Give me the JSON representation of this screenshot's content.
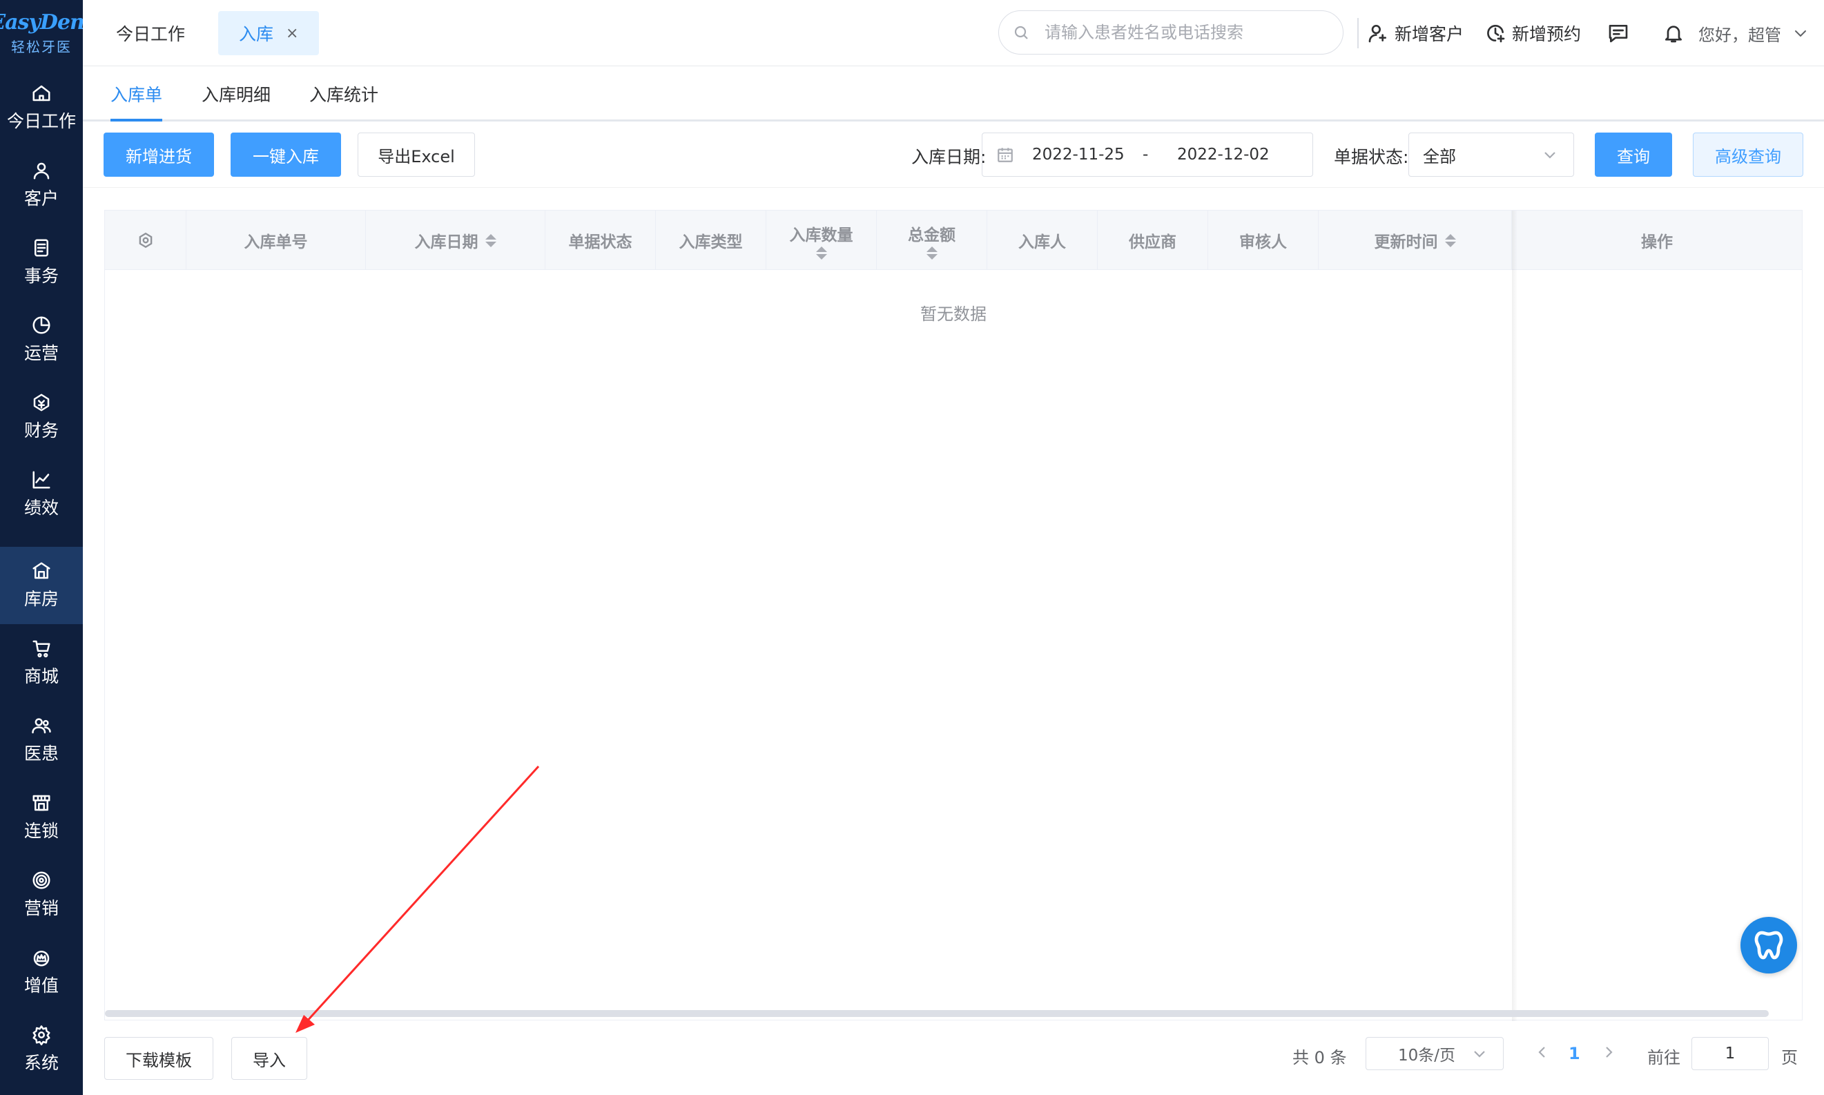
{
  "brand": {
    "logo_main": "EasyDent",
    "logo_sub": "轻松牙医"
  },
  "sidebar": {
    "items": [
      {
        "label": "今日工作",
        "icon": "home-icon"
      },
      {
        "label": "客户",
        "icon": "user-icon"
      },
      {
        "label": "事务",
        "icon": "task-icon"
      },
      {
        "label": "运营",
        "icon": "pie-chart-icon"
      },
      {
        "label": "财务",
        "icon": "finance-icon"
      },
      {
        "label": "绩效",
        "icon": "line-chart-icon"
      },
      {
        "label": "库房",
        "icon": "warehouse-icon",
        "active": true
      },
      {
        "label": "商城",
        "icon": "cart-icon"
      },
      {
        "label": "医患",
        "icon": "people-icon"
      },
      {
        "label": "连锁",
        "icon": "store-icon"
      },
      {
        "label": "营销",
        "icon": "target-icon"
      },
      {
        "label": "增值",
        "icon": "crown-icon"
      },
      {
        "label": "系统",
        "icon": "gear-icon"
      }
    ]
  },
  "topbar": {
    "tabs": [
      {
        "label": "今日工作"
      },
      {
        "label": "入库",
        "active": true,
        "close": "×"
      }
    ],
    "search_placeholder": "请输入患者姓名或电话搜索",
    "add_customer": "新增客户",
    "add_appointment": "新增预约",
    "greeting": "您好，超管"
  },
  "subtabs": [
    {
      "label": "入库单",
      "active": true
    },
    {
      "label": "入库明细"
    },
    {
      "label": "入库统计"
    }
  ],
  "toolbar": {
    "new_purchase": "新增进货",
    "one_click_stock_in": "一键入库",
    "export_excel": "导出Excel",
    "date_label": "入库日期:",
    "date_start": "2022-11-25",
    "date_sep": "-",
    "date_end": "2022-12-02",
    "status_label": "单据状态:",
    "status_value": "全部",
    "query": "查询",
    "advanced_query": "高级查询"
  },
  "table": {
    "columns": [
      "入库单号",
      "入库日期",
      "单据状态",
      "入库类型",
      "入库数量",
      "总金额",
      "入库人",
      "供应商",
      "审核人",
      "更新时间",
      "操作"
    ],
    "empty_text": "暂无数据"
  },
  "bottom": {
    "download_template": "下载模板",
    "import": "导入",
    "total": "共 0 条",
    "page_size": "10条/页",
    "current_page": "1",
    "goto_label": "前往",
    "goto_value": "1",
    "page_unit": "页"
  },
  "colors": {
    "primary": "#409eff",
    "sidebar_bg": "#0f1f3d",
    "sidebar_active": "#1d3a66",
    "annotation_arrow": "#ff2a2a"
  }
}
